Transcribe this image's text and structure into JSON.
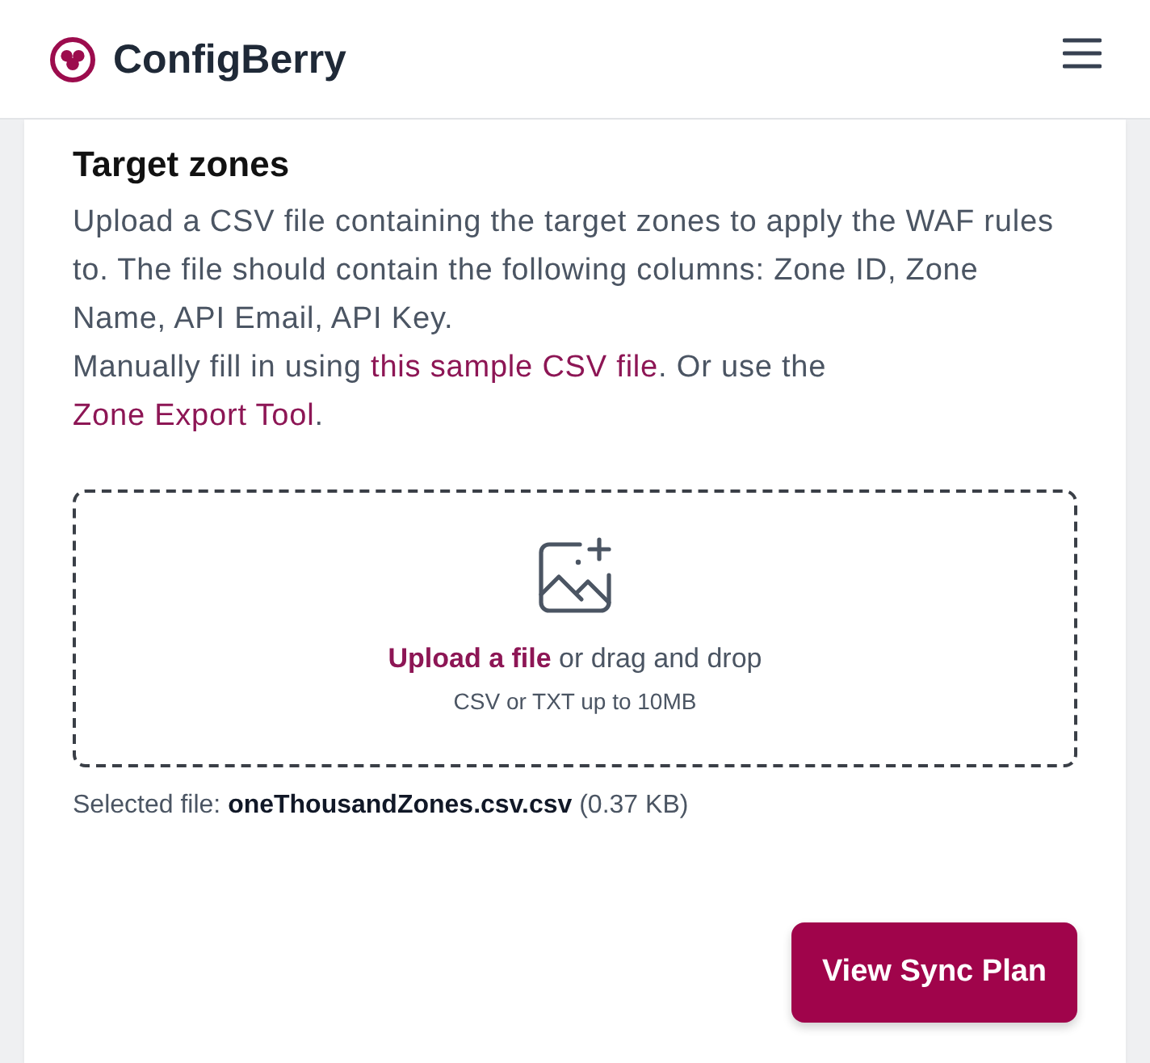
{
  "header": {
    "brand": "ConfigBerry"
  },
  "section": {
    "title": "Target zones",
    "description": "Upload a CSV file containing the target zones to apply the WAF rules to. The file should contain the following columns: Zone ID, Zone Name, API Email, API Key.",
    "help": [
      {
        "kind": "text",
        "text": "Manually fill in using "
      },
      {
        "kind": "link",
        "text": "this sample CSV file"
      },
      {
        "kind": "text",
        "text": ". Or use the "
      },
      {
        "kind": "link",
        "text": "Zone Export Tool"
      },
      {
        "kind": "text",
        "text": "."
      }
    ]
  },
  "upload": {
    "link": "Upload a file",
    "text": " or drag and drop",
    "hint": "CSV or TXT up to 10MB"
  },
  "selected_file": {
    "label": "Selected file:",
    "name": "oneThousandZones.csv.csv",
    "size": "(0.37 KB)"
  },
  "actions": {
    "primary": "View Sync Plan"
  }
}
